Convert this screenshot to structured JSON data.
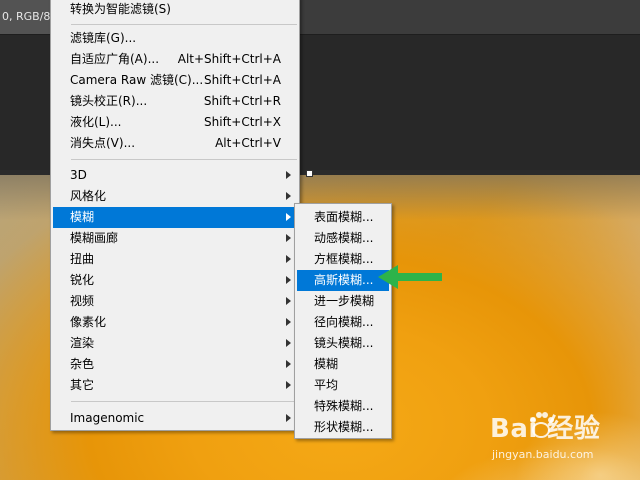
{
  "document_tab": {
    "label": "0, RGB/8#"
  },
  "menu": {
    "items": [
      {
        "label": "转换为智能滤镜(S)",
        "shortcut": ""
      },
      {
        "label": "滤镜库(G)...",
        "shortcut": ""
      },
      {
        "label": "自适应广角(A)...",
        "shortcut": "Alt+Shift+Ctrl+A"
      },
      {
        "label": "Camera Raw 滤镜(C)...",
        "shortcut": "Shift+Ctrl+A"
      },
      {
        "label": "镜头校正(R)...",
        "shortcut": "Shift+Ctrl+R"
      },
      {
        "label": "液化(L)...",
        "shortcut": "Shift+Ctrl+X"
      },
      {
        "label": "消失点(V)...",
        "shortcut": "Alt+Ctrl+V"
      },
      {
        "label": "3D",
        "shortcut": ""
      },
      {
        "label": "风格化",
        "shortcut": ""
      },
      {
        "label": "模糊",
        "shortcut": ""
      },
      {
        "label": "模糊画廊",
        "shortcut": ""
      },
      {
        "label": "扭曲",
        "shortcut": ""
      },
      {
        "label": "锐化",
        "shortcut": ""
      },
      {
        "label": "视频",
        "shortcut": ""
      },
      {
        "label": "像素化",
        "shortcut": ""
      },
      {
        "label": "渲染",
        "shortcut": ""
      },
      {
        "label": "杂色",
        "shortcut": ""
      },
      {
        "label": "其它",
        "shortcut": ""
      },
      {
        "label": "Imagenomic",
        "shortcut": ""
      }
    ],
    "highlighted": "模糊"
  },
  "submenu": {
    "items": [
      {
        "label": "表面模糊..."
      },
      {
        "label": "动感模糊..."
      },
      {
        "label": "方框模糊..."
      },
      {
        "label": "高斯模糊..."
      },
      {
        "label": "进一步模糊"
      },
      {
        "label": "径向模糊..."
      },
      {
        "label": "镜头模糊..."
      },
      {
        "label": "模糊"
      },
      {
        "label": "平均"
      },
      {
        "label": "特殊模糊..."
      },
      {
        "label": "形状模糊..."
      }
    ],
    "highlighted": "高斯模糊..."
  },
  "watermark": {
    "brand": "Bai  经验",
    "url": "jingyan.baidu.com"
  },
  "colors": {
    "highlight": "#0078d7",
    "annotation_arrow": "#2db34a",
    "menu_bg": "#f0f0f0"
  },
  "icons": {
    "submenu_arrow": "triangle-right",
    "annotation": "green-arrow-left",
    "watermark_logo": "baidu-paw"
  }
}
